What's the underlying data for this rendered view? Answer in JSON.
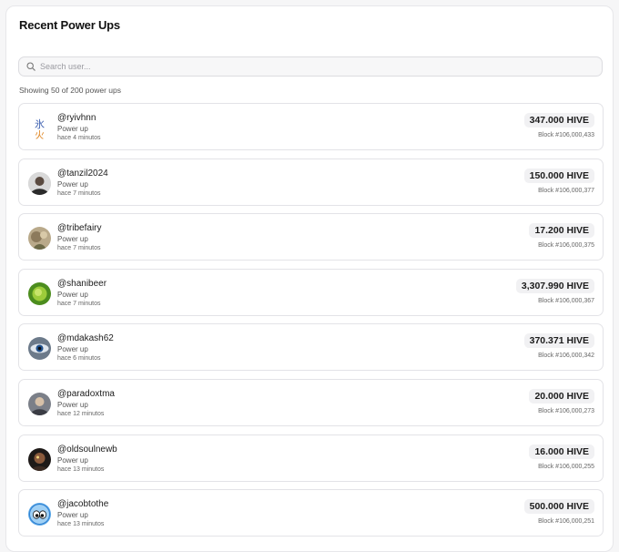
{
  "page": {
    "title": "Recent Power Ups"
  },
  "search": {
    "placeholder": "Search user..."
  },
  "summary": {
    "text": "Showing 50 of 200 power ups"
  },
  "powerups": [
    {
      "user": "@ryivhnn",
      "type": "Power up",
      "time": "hace 4 minutos",
      "amount": "347.000 HIVE",
      "block": "Block #106,000,433",
      "avatar": "kanji-avatar"
    },
    {
      "user": "@tanzil2024",
      "type": "Power up",
      "time": "hace 7 minutos",
      "amount": "150.000 HIVE",
      "block": "Block #106,000,377",
      "avatar": "person-avatar"
    },
    {
      "user": "@tribefairy",
      "type": "Power up",
      "time": "hace 7 minutos",
      "amount": "17.200 HIVE",
      "block": "Block #106,000,375",
      "avatar": "fairy-avatar"
    },
    {
      "user": "@shanibeer",
      "type": "Power up",
      "time": "hace 7 minutos",
      "amount": "3,307.990 HIVE",
      "block": "Block #106,000,367",
      "avatar": "leaf-avatar"
    },
    {
      "user": "@mdakash62",
      "type": "Power up",
      "time": "hace 6 minutos",
      "amount": "370.371 HIVE",
      "block": "Block #106,000,342",
      "avatar": "eye-avatar"
    },
    {
      "user": "@paradoxtma",
      "type": "Power up",
      "time": "hace 12 minutos",
      "amount": "20.000 HIVE",
      "block": "Block #106,000,273",
      "avatar": "person-avatar"
    },
    {
      "user": "@oldsoulnewb",
      "type": "Power up",
      "time": "hace 13 minutos",
      "amount": "16.000 HIVE",
      "block": "Block #106,000,255",
      "avatar": "dark-person-avatar"
    },
    {
      "user": "@jacobtothe",
      "type": "Power up",
      "time": "hace 13 minutos",
      "amount": "500.000 HIVE",
      "block": "Block #106,000,251",
      "avatar": "cartoon-eyes-avatar"
    }
  ]
}
